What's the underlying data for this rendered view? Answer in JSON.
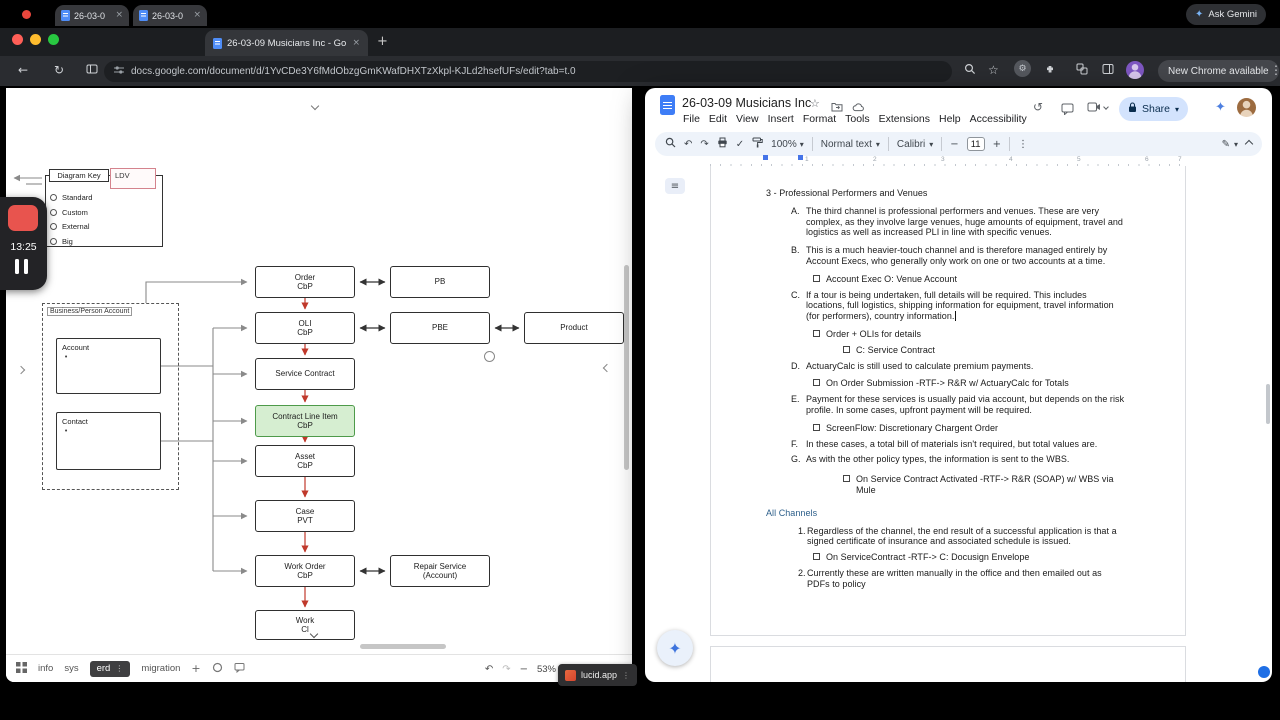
{
  "icons": {
    "back": "←",
    "reload": "↻",
    "undo": "↶",
    "redo": "↷",
    "minus": "−",
    "plus": "+",
    "kebab": "⋮",
    "close": "×",
    "star": "☆",
    "check": "✓",
    "pen": "✎",
    "sparkle": "✦",
    "history": "↺",
    "outline": "≡",
    "bullet": "•",
    "gear": "⚙",
    "dropdown": "▾"
  },
  "colors": {
    "cli_green": "#d6eed1",
    "share_blue": "#d3e3fd",
    "record_red": "#e8544e",
    "docs_blue": "#3e7df6"
  },
  "chrome": {
    "back_tabs": [
      "26-03-0",
      "26-03-0"
    ],
    "ask_gemini_label": "Ask Gemini",
    "active_tab_label": "26-03-09 Musicians Inc - Go...",
    "url": "docs.google.com/document/d/1YvCDe3Y6fMdObzgGmKWafDHXTzXkpl-KJLd2hsefUFs/edit?tab=t.0",
    "new_chrome_label": "New Chrome available"
  },
  "recorder": {
    "time": "13:25"
  },
  "lucid": {
    "key": {
      "title": "Diagram Key",
      "options": [
        "Standard",
        "Custom",
        "External",
        "Big"
      ],
      "ldv": "LDV"
    },
    "container": {
      "label": "Business/Person Account",
      "account": "Account",
      "contact": "Contact"
    },
    "boxes": {
      "order": {
        "l1": "Order",
        "l2": "CbP"
      },
      "oli": {
        "l1": "OLI",
        "l2": "CbP"
      },
      "service_contract": {
        "l1": "Service Contract"
      },
      "contract_line_item": {
        "l1": "Contract Line Item",
        "l2": "CbP"
      },
      "asset": {
        "l1": "Asset",
        "l2": "CbP"
      },
      "case": {
        "l1": "Case",
        "l2": "PVT"
      },
      "work_order": {
        "l1": "Work Order",
        "l2": "CbP"
      },
      "work_partial": {
        "l1": "Work",
        "l2": "Cl"
      },
      "pb": {
        "l1": "PB"
      },
      "pbe": {
        "l1": "PBE"
      },
      "product": {
        "l1": "Product"
      },
      "repair": {
        "l1": "Repair Service",
        "l2": "(Account)"
      }
    },
    "footer": {
      "tabs": [
        "info",
        "sys",
        "erd",
        "migration"
      ],
      "zoom": "53%",
      "badge": "lucid.app"
    }
  },
  "docs": {
    "title": "26-03-09 Musicians Inc",
    "menus": [
      "File",
      "Edit",
      "View",
      "Insert",
      "Format",
      "Tools",
      "Extensions",
      "Help",
      "Accessibility"
    ],
    "share_label": "Share",
    "toolbar": {
      "zoom": "100%",
      "style": "Normal text",
      "font": "Calibri",
      "size": "11"
    },
    "ruler": [
      "1",
      "2",
      "3",
      "4",
      "5",
      "6",
      "7"
    ],
    "body": [
      {
        "t": "h3",
        "text": "3 - Professional Performers and Venues"
      },
      {
        "t": "alpha",
        "label": "A.",
        "text": "The third channel is professional performers and venues. These are very complex, as they involve large venues, huge amounts of equipment, travel and logistics as well as increased PLI in line with specific venues."
      },
      {
        "t": "alpha",
        "label": "B.",
        "text": "This is a much heavier-touch channel and is therefore managed entirely by Account Execs, who generally only work on one or two accounts at a time."
      },
      {
        "t": "check1",
        "text": "Account Exec  O: Venue Account"
      },
      {
        "t": "alpha",
        "label": "C.",
        "text": "If a tour is being undertaken, full details will be required. This includes locations, full logistics, shipping information for equipment, travel information (for performers), country information."
      },
      {
        "t": "check1",
        "text": "Order + OLIs for details"
      },
      {
        "t": "check2",
        "text": "C: Service Contract"
      },
      {
        "t": "alpha",
        "label": "D.",
        "text": "ActuaryCalc is still used to calculate premium payments."
      },
      {
        "t": "check1",
        "text": "On Order Submission -RTF-> R&R w/ ActuaryCalc for Totals"
      },
      {
        "t": "alpha",
        "label": "E.",
        "text": "Payment for these services is usually paid via account, but depends on the risk profile. In some cases, upfront payment will be required."
      },
      {
        "t": "check1",
        "text": "ScreenFlow: Discretionary Chargent Order"
      },
      {
        "t": "alpha",
        "label": "F.",
        "text": "In these cases, a total bill of materials isn't required, but total values are."
      },
      {
        "t": "alpha",
        "label": "G.",
        "text": "As with the other policy types, the information is sent to the WBS."
      },
      {
        "t": "check2",
        "text": "On Service Contract Activated -RTF-> R&R (SOAP) w/ WBS via Mule"
      },
      {
        "t": "hAll",
        "text": "All Channels"
      },
      {
        "t": "num",
        "label": "1.",
        "text": "Regardless of the channel, the end result of a successful application is that a signed certificate of insurance and associated schedule is issued."
      },
      {
        "t": "check1",
        "text": "On ServiceContract -RTF-> C: Docusign Envelope"
      },
      {
        "t": "num",
        "label": "2.",
        "text": "Currently these are written manually in the office and then emailed out as PDFs to policy"
      }
    ]
  }
}
